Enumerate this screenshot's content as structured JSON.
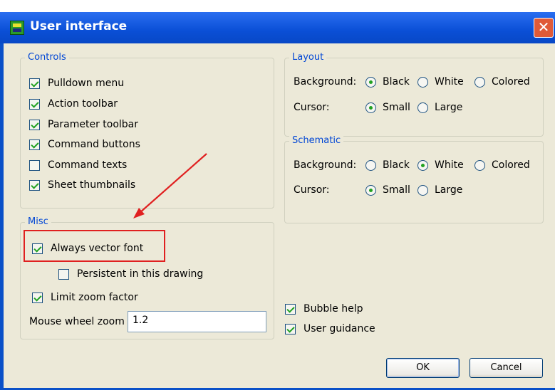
{
  "window": {
    "title": "User interface",
    "close_glyph": "✕"
  },
  "controls": {
    "legend": "Controls",
    "items": [
      {
        "label": "Pulldown menu",
        "checked": true
      },
      {
        "label": "Action toolbar",
        "checked": true
      },
      {
        "label": "Parameter toolbar",
        "checked": true
      },
      {
        "label": "Command buttons",
        "checked": true
      },
      {
        "label": "Command texts",
        "checked": false
      },
      {
        "label": "Sheet thumbnails",
        "checked": true
      }
    ]
  },
  "misc": {
    "legend": "Misc",
    "always_vector_font": {
      "label": "Always vector font",
      "checked": true
    },
    "persistent": {
      "label": "Persistent in this drawing",
      "checked": false
    },
    "limit_zoom": {
      "label": "Limit zoom factor",
      "checked": true
    },
    "mouse_wheel_label": "Mouse wheel zoom",
    "mouse_wheel_value": "1.2"
  },
  "layout": {
    "legend": "Layout",
    "background_label": "Background:",
    "background_options": [
      "Black",
      "White",
      "Colored"
    ],
    "background_selected": "Black",
    "cursor_label": "Cursor:",
    "cursor_options": [
      "Small",
      "Large"
    ],
    "cursor_selected": "Small"
  },
  "schematic": {
    "legend": "Schematic",
    "background_label": "Background:",
    "background_options": [
      "Black",
      "White",
      "Colored"
    ],
    "background_selected": "White",
    "cursor_label": "Cursor:",
    "cursor_options": [
      "Small",
      "Large"
    ],
    "cursor_selected": "Small"
  },
  "bottom": {
    "bubble_help": {
      "label": "Bubble help",
      "checked": true
    },
    "user_guidance": {
      "label": "User guidance",
      "checked": true
    }
  },
  "buttons": {
    "ok": "OK",
    "cancel": "Cancel"
  },
  "colors": {
    "title_bar": "#0a4fd6",
    "legend_text": "#0046d5",
    "annotation": "#e02020",
    "check": "#21a121"
  }
}
